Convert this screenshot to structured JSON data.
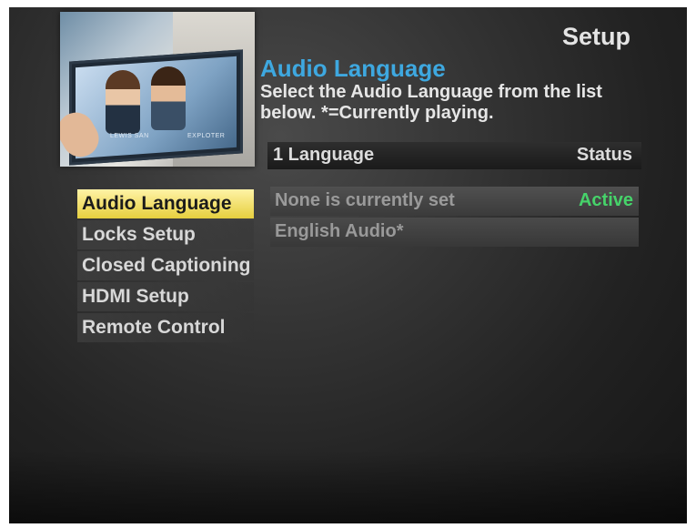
{
  "page_title": "Setup",
  "preview": {
    "label_left": "LEWIS SAN",
    "label_right": "EXPLOTER"
  },
  "section": {
    "heading": "Audio Language",
    "description": "Select the Audio Language from the list below. *=Currently playing."
  },
  "table": {
    "header_left": "1 Language",
    "header_right": "Status",
    "rows": [
      {
        "name": "None is currently set",
        "status": "Active"
      },
      {
        "name": "English Audio*",
        "status": ""
      }
    ]
  },
  "menu": {
    "items": [
      {
        "label": "Audio Language",
        "selected": true
      },
      {
        "label": "Locks Setup",
        "selected": false
      },
      {
        "label": "Closed Captioning",
        "selected": false
      },
      {
        "label": "HDMI Setup",
        "selected": false
      },
      {
        "label": "Remote Control",
        "selected": false
      }
    ]
  },
  "colors": {
    "heading": "#3ea8e0",
    "status_active": "#46d36a",
    "selected_bg": "#e6cf3e"
  }
}
